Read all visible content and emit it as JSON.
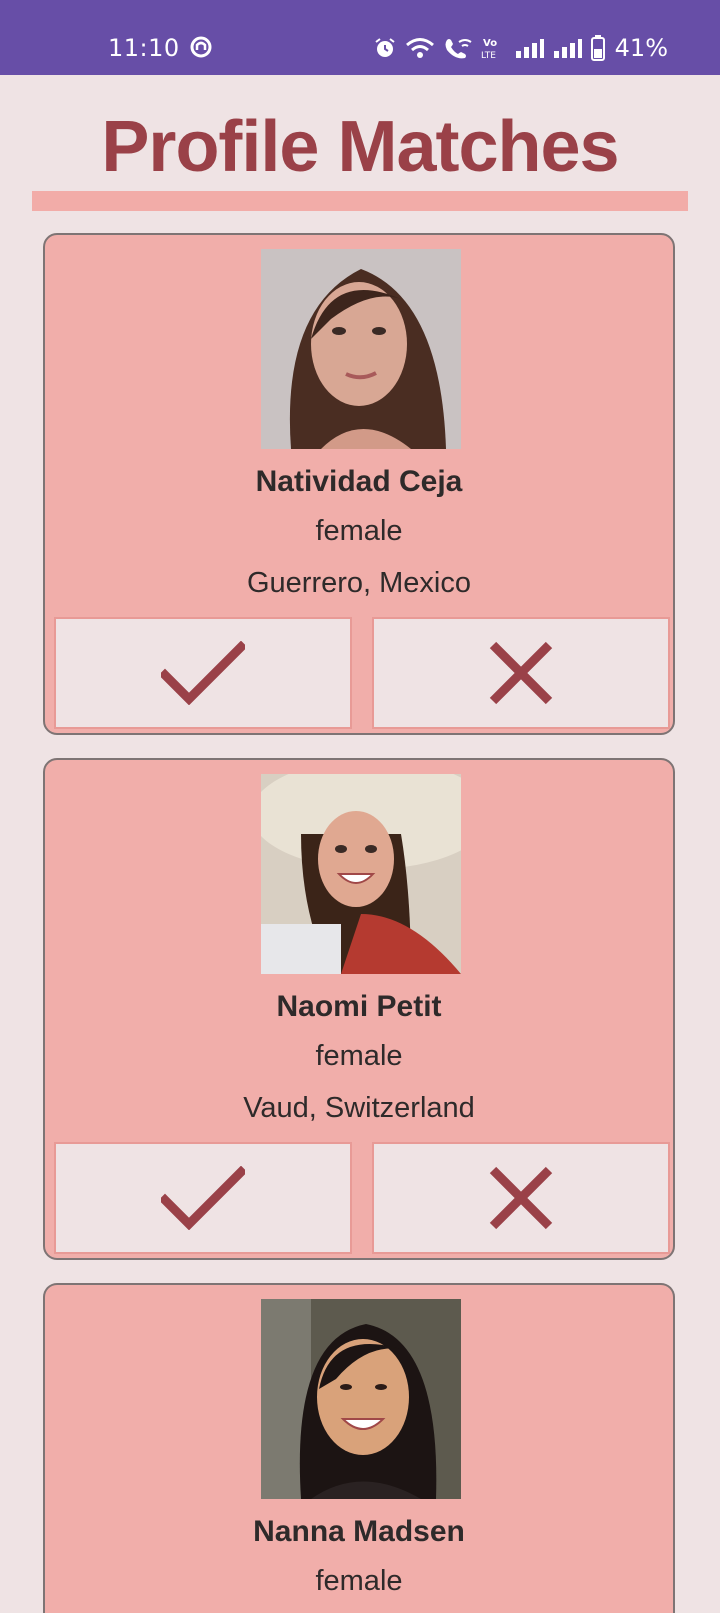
{
  "status_bar": {
    "time": "11:10",
    "battery_percent": "41%",
    "icons": [
      "app-notification-icon",
      "alarm-icon",
      "wifi-icon",
      "wifi-calling-icon",
      "volte-icon",
      "signal-icon",
      "signal-icon",
      "battery-icon"
    ]
  },
  "page": {
    "title": "Profile Matches"
  },
  "colors": {
    "status_bar": "#674ea7",
    "background": "#efe3e4",
    "title": "#9a4148",
    "card": "#f1aeaa",
    "accent_bar": "#f2aca8",
    "action_icon": "#9a4148"
  },
  "profiles": [
    {
      "name": "Natividad Ceja",
      "gender": "female",
      "location": "Guerrero, Mexico",
      "photo": "profile-photo"
    },
    {
      "name": "Naomi Petit",
      "gender": "female",
      "location": "Vaud, Switzerland",
      "photo": "profile-photo"
    },
    {
      "name": "Nanna Madsen",
      "gender": "female",
      "location": "",
      "photo": "profile-photo"
    }
  ],
  "actions": {
    "accept_icon": "check-icon",
    "reject_icon": "close-icon"
  }
}
